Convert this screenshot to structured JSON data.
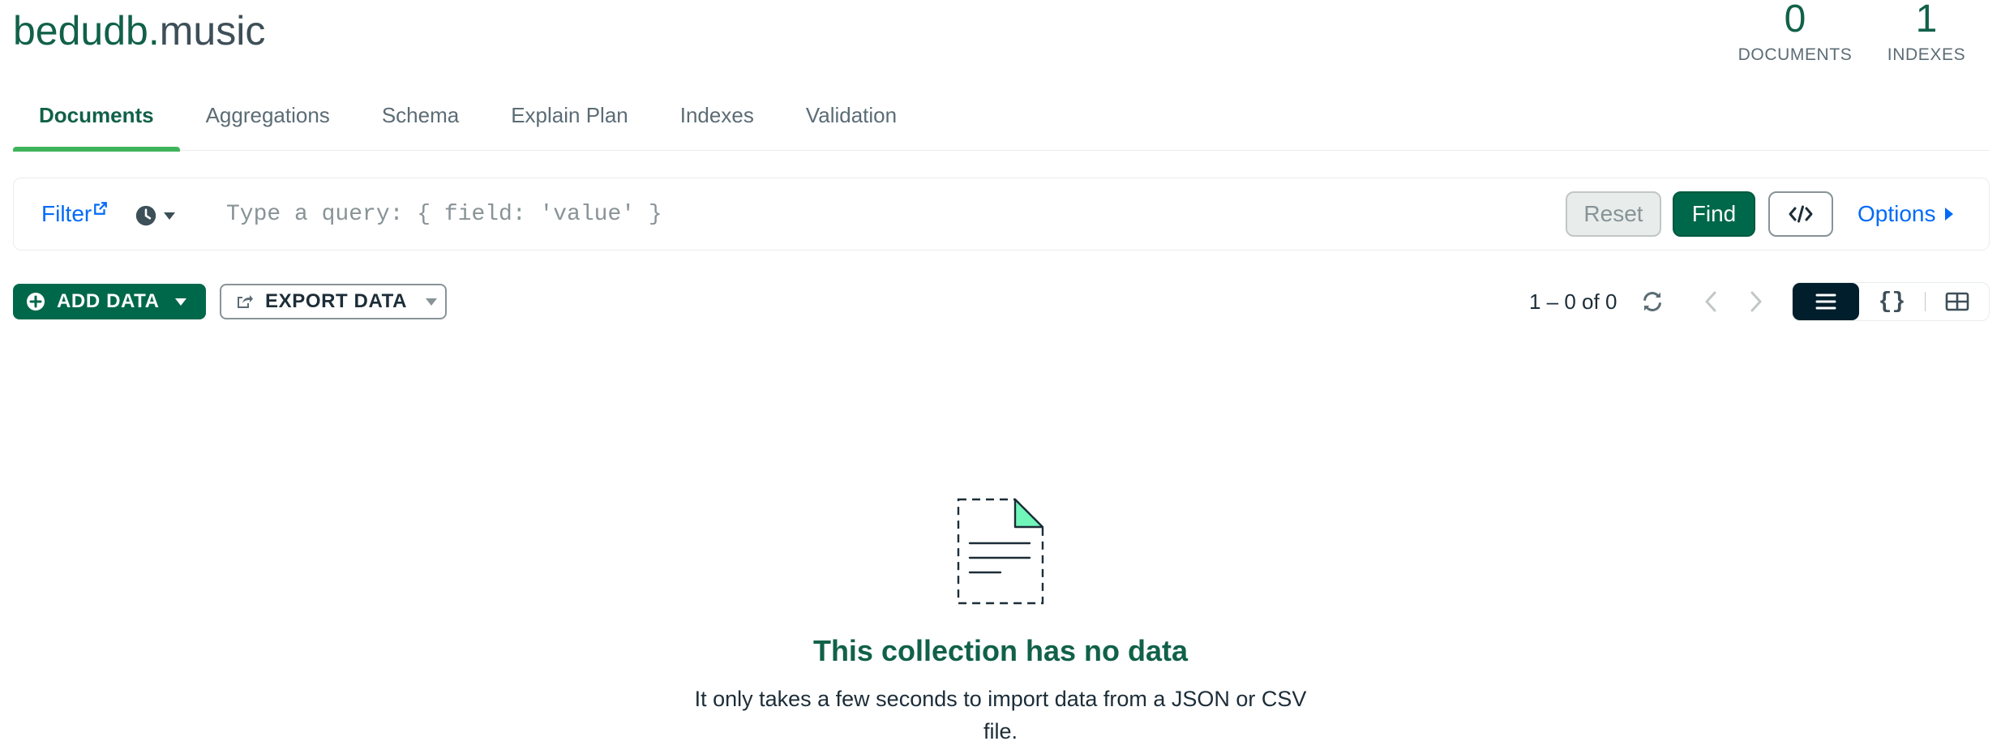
{
  "namespace": {
    "database": "bedudb",
    "separator": ".",
    "collection": "music"
  },
  "stats": {
    "documents": {
      "value": "0",
      "label": "DOCUMENTS"
    },
    "indexes": {
      "value": "1",
      "label": "INDEXES"
    }
  },
  "tabs": [
    {
      "label": "Documents",
      "active": true
    },
    {
      "label": "Aggregations",
      "active": false
    },
    {
      "label": "Schema",
      "active": false
    },
    {
      "label": "Explain Plan",
      "active": false
    },
    {
      "label": "Indexes",
      "active": false
    },
    {
      "label": "Validation",
      "active": false
    }
  ],
  "query_bar": {
    "filter_label": "Filter",
    "placeholder": "Type a query: { field: 'value' }",
    "value": "",
    "reset_label": "Reset",
    "find_label": "Find",
    "options_label": "Options"
  },
  "toolbar": {
    "add_data_label": "ADD DATA",
    "export_data_label": "EXPORT DATA",
    "pagination_text": "1 – 0 of 0",
    "json_view_label": "{}"
  },
  "empty_state": {
    "title": "This collection has no data",
    "description": "It only takes a few seconds to import data from a JSON or CSV file."
  },
  "colors": {
    "brand_green": "#00684a",
    "accent_green": "#3fb45b",
    "title_green": "#116149",
    "link_blue": "#016bf8",
    "dark_navy": "#001e2b"
  },
  "icons": {
    "filter_external": "external-link-icon",
    "history": "clock-icon",
    "code": "code-icon",
    "options": "triangle-right-icon",
    "add": "plus-circle-icon",
    "export": "export-icon",
    "refresh": "refresh-icon",
    "prev": "chevron-left-icon",
    "next": "chevron-right-icon",
    "list_view": "list-icon",
    "json_view": "curly-braces-icon",
    "table_view": "table-icon",
    "empty": "empty-document-icon"
  }
}
